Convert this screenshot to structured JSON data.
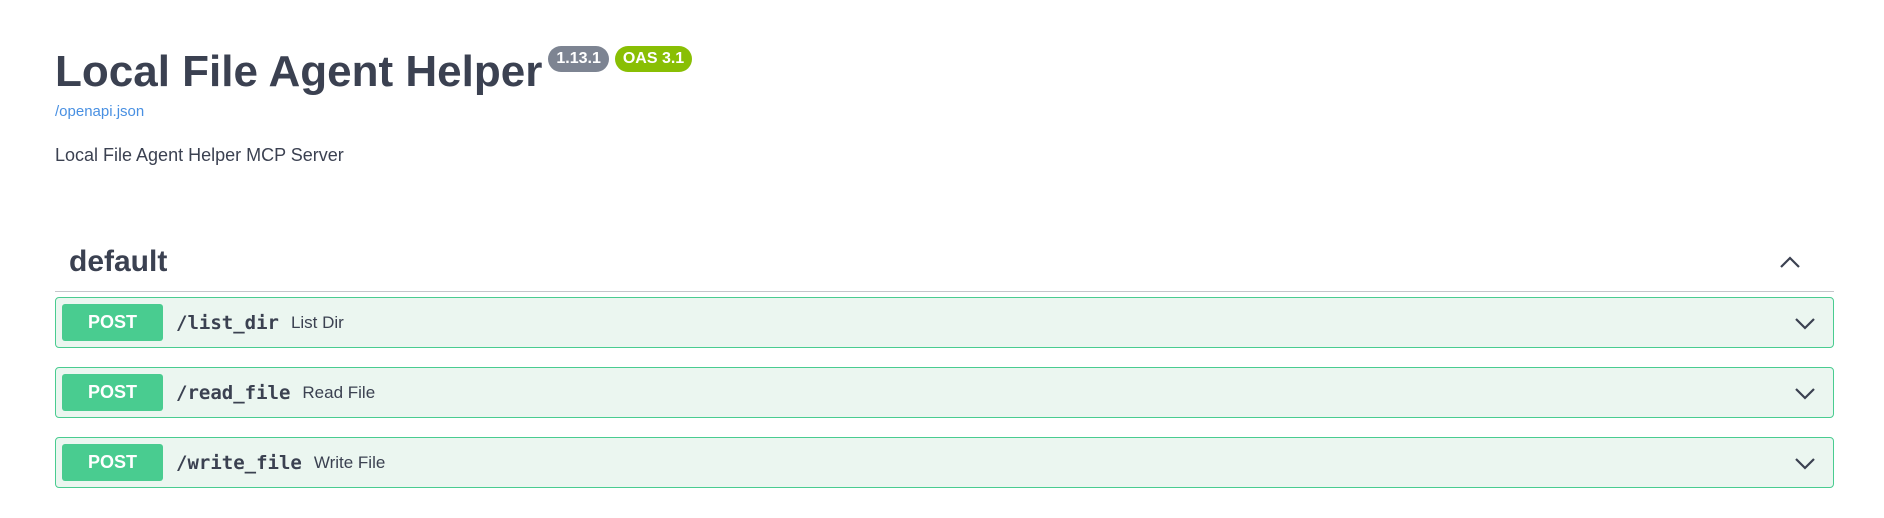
{
  "info": {
    "title": "Local File Agent Helper",
    "version_badge": "1.13.1",
    "oas_badge": "OAS 3.1",
    "spec_link": "/openapi.json",
    "description": "Local File Agent Helper MCP Server"
  },
  "section": {
    "title": "default",
    "toggle_icon": "chevron-up-icon"
  },
  "operations": [
    {
      "method": "POST",
      "path": "/list_dir",
      "summary": "List Dir",
      "toggle_icon": "chevron-down-icon"
    },
    {
      "method": "POST",
      "path": "/read_file",
      "summary": "Read File",
      "toggle_icon": "chevron-down-icon"
    },
    {
      "method": "POST",
      "path": "/write_file",
      "summary": "Write File",
      "toggle_icon": "chevron-down-icon"
    }
  ],
  "colors": {
    "text": "#3b4151",
    "post": "#49cc90",
    "post_bg": "#ebf6f0",
    "version_badge": "#7d8492",
    "oas_badge": "#89bf04",
    "link": "#4990e2"
  }
}
